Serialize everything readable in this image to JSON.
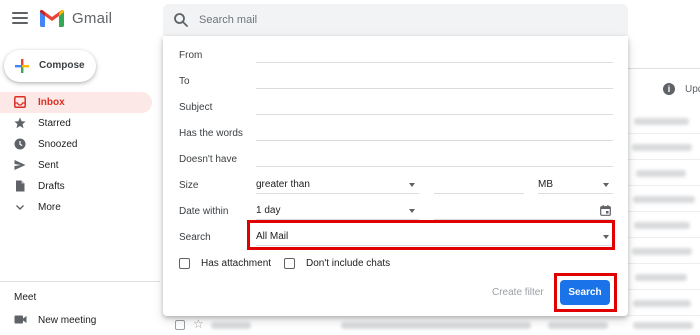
{
  "app": {
    "name": "Gmail"
  },
  "search": {
    "placeholder": "Search mail"
  },
  "sidebar": {
    "compose_label": "Compose",
    "items": [
      {
        "label": "Inbox",
        "icon": "inbox-icon",
        "active": true
      },
      {
        "label": "Starred",
        "icon": "star-icon"
      },
      {
        "label": "Snoozed",
        "icon": "clock-icon"
      },
      {
        "label": "Sent",
        "icon": "send-icon"
      },
      {
        "label": "Drafts",
        "icon": "draft-icon"
      },
      {
        "label": "More",
        "icon": "chevron-down-icon"
      }
    ],
    "meet": {
      "title": "Meet",
      "new_meeting": "New meeting"
    }
  },
  "list": {
    "header_text": "Upd"
  },
  "panel": {
    "labels": {
      "from": "From",
      "to": "To",
      "subject": "Subject",
      "has_words": "Has the words",
      "doesnt_have": "Doesn't have",
      "size": "Size",
      "date_within": "Date within",
      "search": "Search"
    },
    "size_operator": "greater than",
    "size_unit": "MB",
    "date_within_value": "1 day",
    "search_scope": "All Mail",
    "has_attachment": "Has attachment",
    "dont_include_chats": "Don't include chats",
    "create_filter": "Create filter",
    "search_button": "Search"
  },
  "colors": {
    "accent": "#1a73e8",
    "inbox_active_bg": "#fce8e6",
    "inbox_active_text": "#d93025",
    "highlight": "#e00000"
  }
}
